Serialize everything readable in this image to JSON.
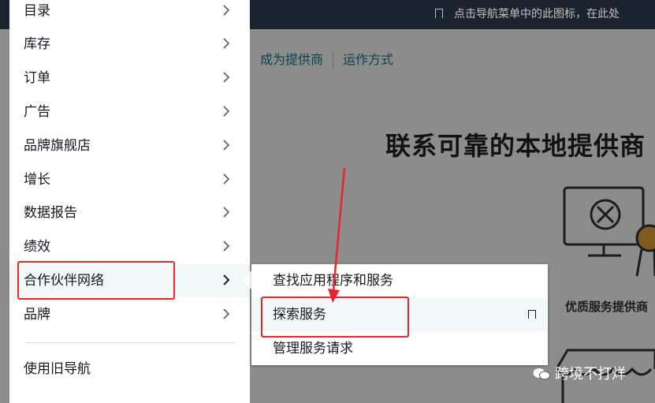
{
  "topbar": {
    "hint_text": "点击导航菜单中的此图标，在此处"
  },
  "subnav": {
    "link1": "成为提供商",
    "link2": "运作方式"
  },
  "hero": {
    "headline": "联系可靠的本地提供商",
    "illustration_label": "优质服务提供商"
  },
  "menu": {
    "items": [
      {
        "label": "目录"
      },
      {
        "label": "库存"
      },
      {
        "label": "订单"
      },
      {
        "label": "广告"
      },
      {
        "label": "品牌旗舰店"
      },
      {
        "label": "增长"
      },
      {
        "label": "数据报告"
      },
      {
        "label": "绩效"
      },
      {
        "label": "合作伙伴网络"
      },
      {
        "label": "品牌"
      }
    ],
    "legacy_nav": "使用旧导航"
  },
  "flyout": {
    "items": [
      {
        "label": "查找应用程序和服务"
      },
      {
        "label": "探索服务"
      },
      {
        "label": "管理服务请求"
      }
    ]
  },
  "watermark": {
    "text": "跨境不打烊"
  },
  "colors": {
    "annotation_red": "#e8262a",
    "link_teal": "#0f7b8a",
    "topbar": "#232f3e"
  }
}
